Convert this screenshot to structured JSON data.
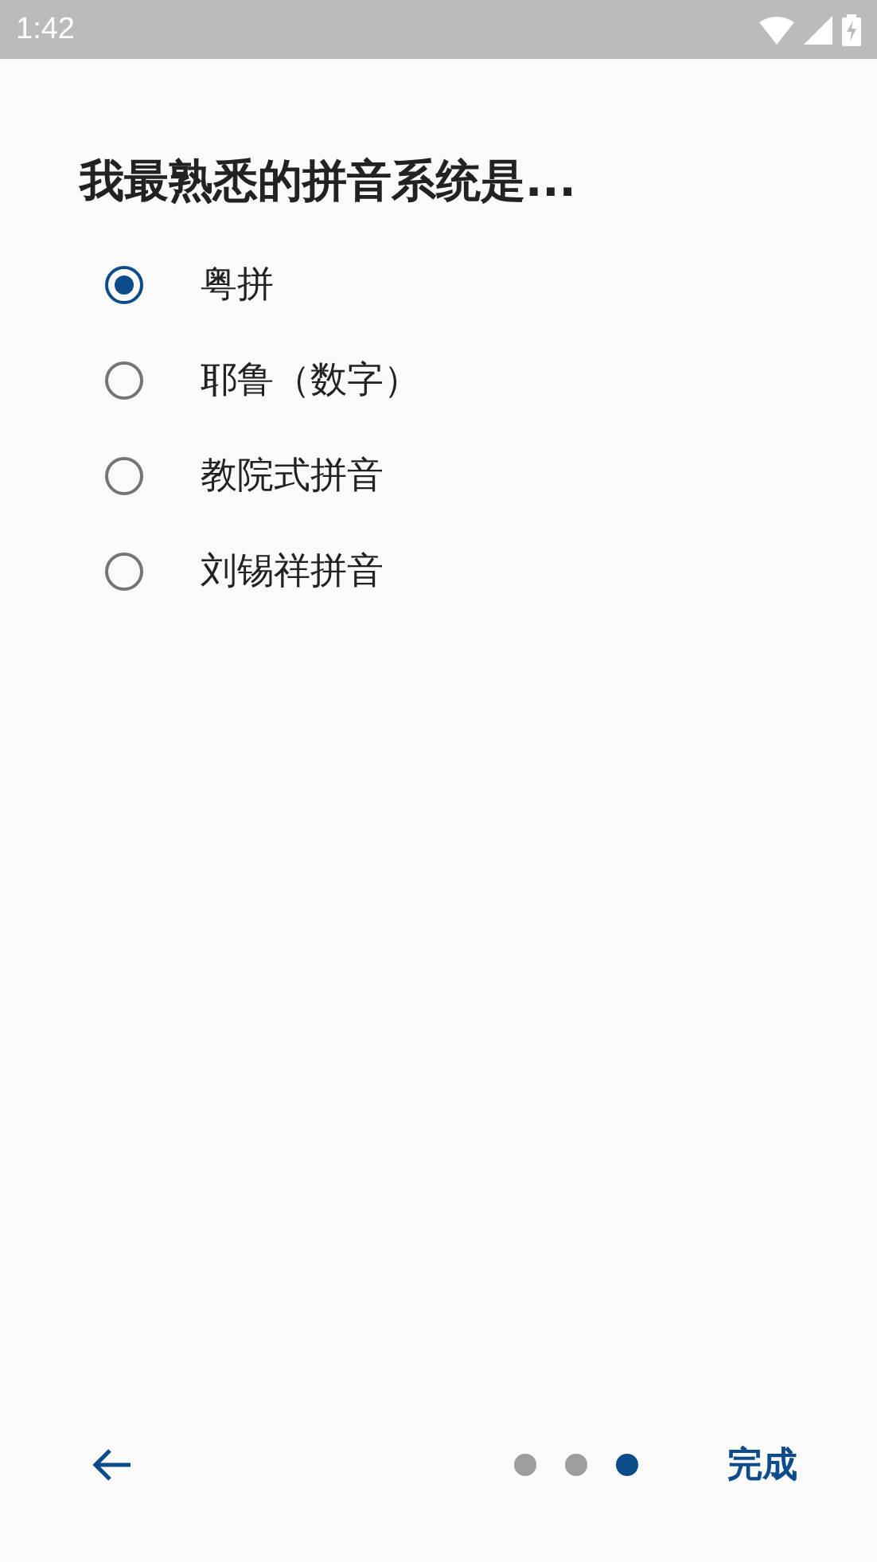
{
  "status_bar": {
    "time": "1:42"
  },
  "title": "我最熟悉的拼音系统是...",
  "options": [
    {
      "label": "粤拼",
      "selected": true
    },
    {
      "label": "耶鲁（数字）",
      "selected": false
    },
    {
      "label": "教院式拼音",
      "selected": false
    },
    {
      "label": "刘锡祥拼音",
      "selected": false
    }
  ],
  "pager": [
    {
      "selected": false
    },
    {
      "selected": false
    },
    {
      "selected": true
    }
  ],
  "finish_button": "完成"
}
